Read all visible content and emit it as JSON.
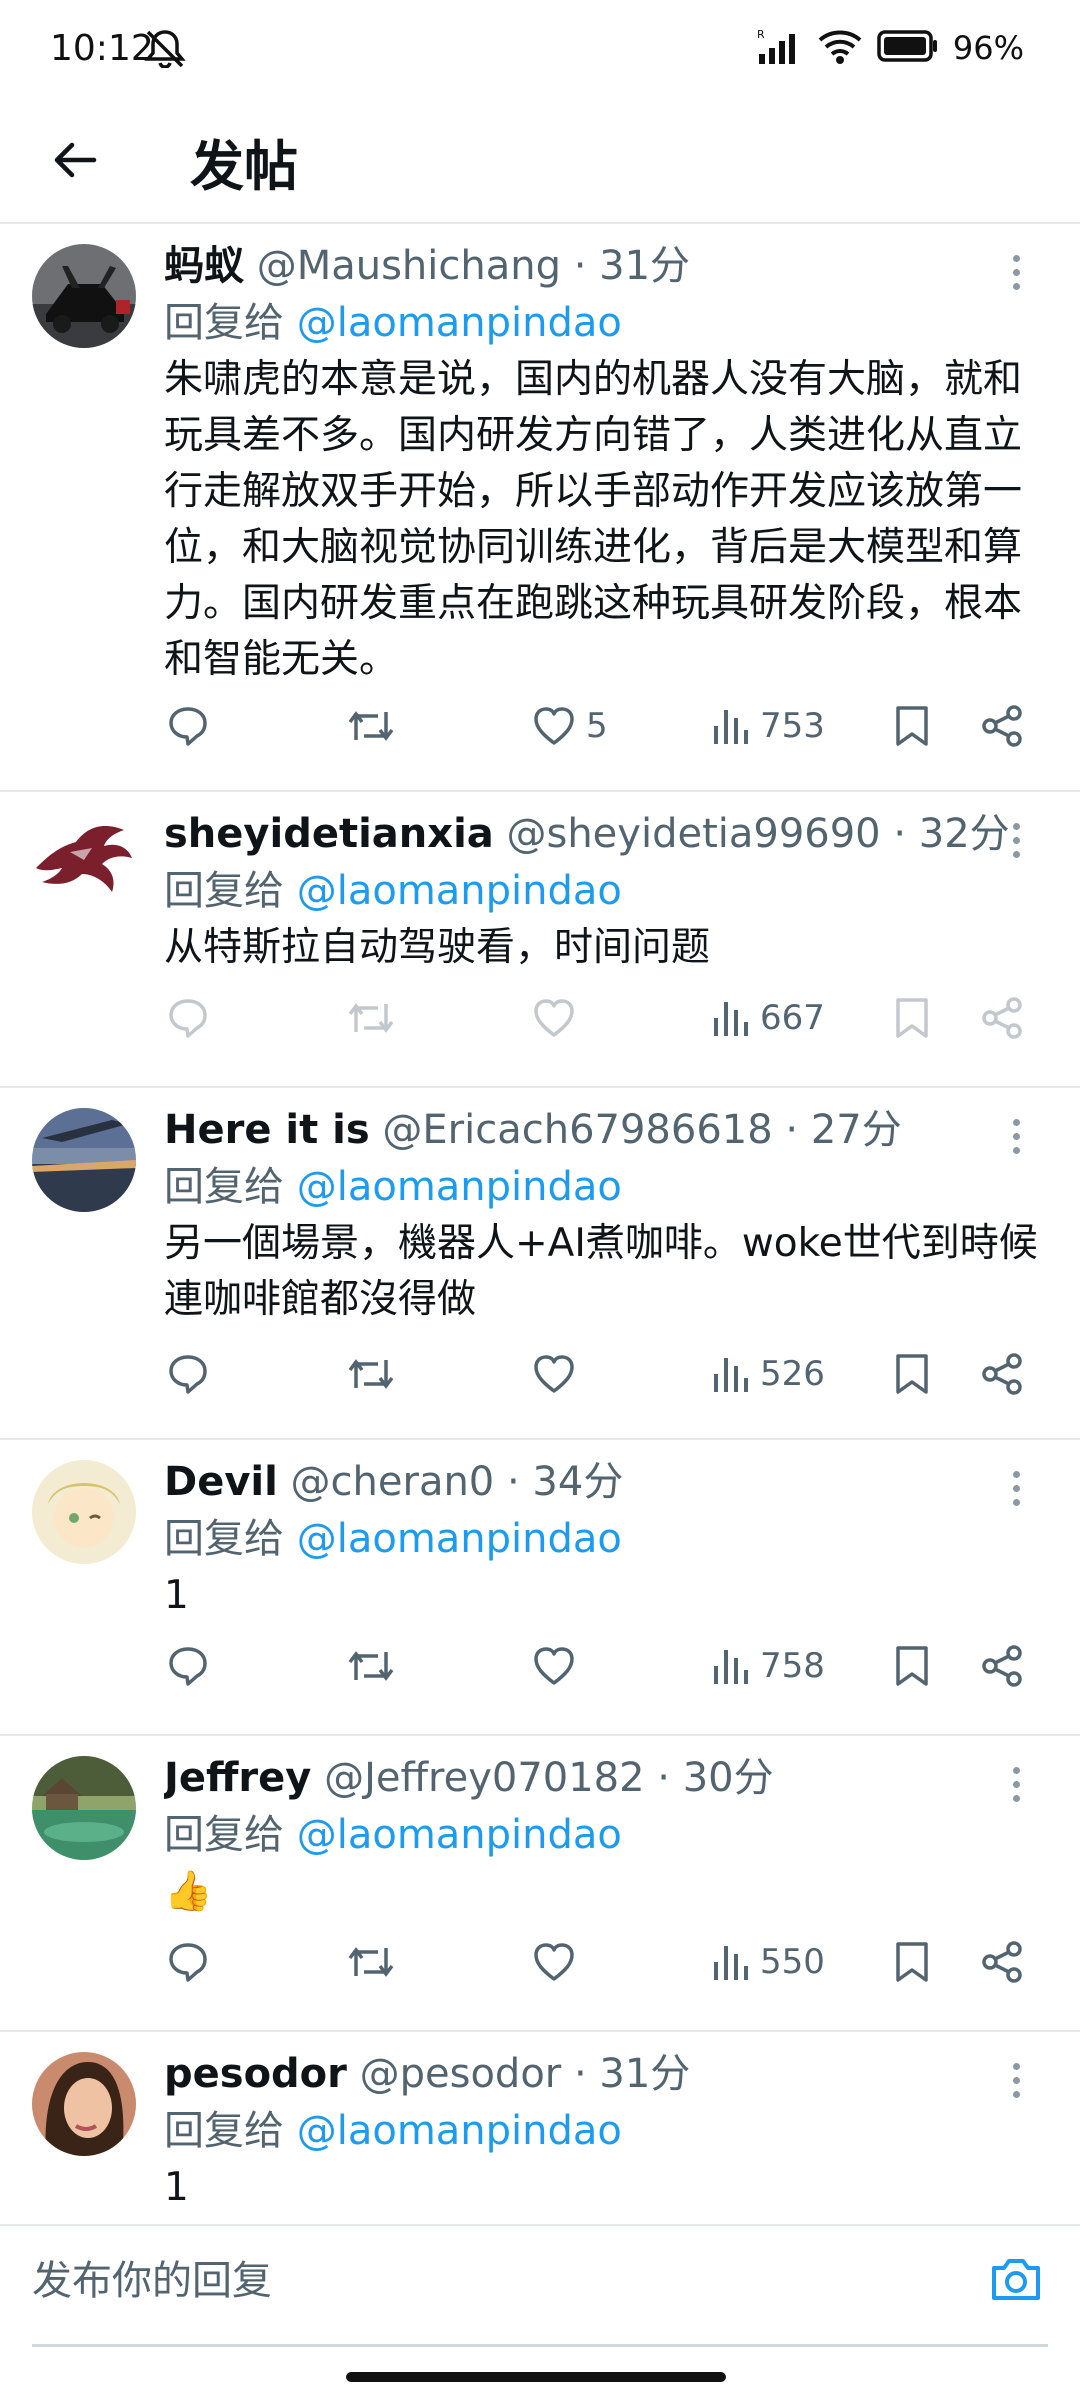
{
  "status_bar": {
    "time": "10:12",
    "battery": "96%"
  },
  "header": {
    "title": "发帖"
  },
  "tweets": [
    {
      "name": "蚂蚁",
      "handle": "@Maushichang",
      "time": "31分",
      "reply_prefix": "回复给",
      "reply_to": "@laomanpindao",
      "text": "朱啸虎的本意是说，国内的机器人没有大脑，就和玩具差不多。国内研发方向错了，人类进化从直立行走解放双手开始，所以手部动作开发应该放第一位，和大脑视觉协同训练进化，背后是大模型和算力。国内研发重点在跑跳这种玩具研发阶段，根本和智能无关。",
      "likes": "5",
      "views": "753"
    },
    {
      "name": "sheyidetianxia",
      "handle": "@sheyidetia99690",
      "time": "32分",
      "reply_prefix": "回复给",
      "reply_to": "@laomanpindao",
      "text": "从特斯拉自动驾驶看，时间问题",
      "likes": "",
      "views": "667"
    },
    {
      "name": "Here it is",
      "handle": "@Ericach67986618",
      "time": "27分",
      "reply_prefix": "回复给",
      "reply_to": "@laomanpindao",
      "text": "另一個場景，機器人+AI煮咖啡。woke世代到時候連咖啡館都沒得做",
      "likes": "",
      "views": "526"
    },
    {
      "name": "Devil",
      "handle": "@cheran0",
      "time": "34分",
      "reply_prefix": "回复给",
      "reply_to": "@laomanpindao",
      "text": "1",
      "likes": "",
      "views": "758"
    },
    {
      "name": "Jeffrey",
      "handle": "@Jeffrey070182",
      "time": "30分",
      "reply_prefix": "回复给",
      "reply_to": "@laomanpindao",
      "text": "👍",
      "likes": "",
      "views": "550"
    },
    {
      "name": "pesodor",
      "handle": "@pesodor",
      "time": "31分",
      "reply_prefix": "回复给",
      "reply_to": "@laomanpindao",
      "text": "1",
      "likes": "",
      "views": ""
    }
  ],
  "compose": {
    "placeholder": "发布你的回复"
  },
  "colors": {
    "link": "#1d9bf0",
    "secondary_text": "#536471",
    "divider": "#e6e9ec"
  }
}
